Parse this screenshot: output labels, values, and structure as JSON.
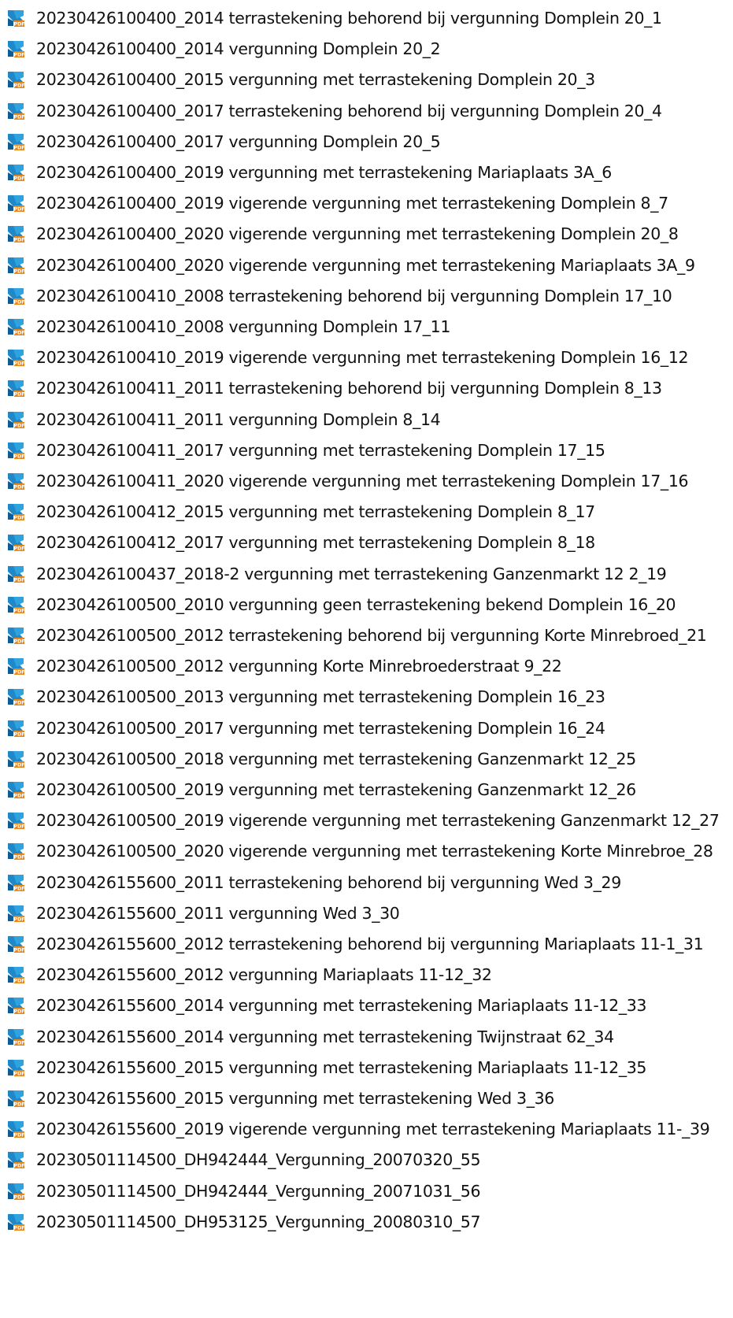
{
  "file_list": {
    "icon": "pdf-file-icon",
    "colors": {
      "icon_blue": "#1e88c8",
      "icon_blue_dark": "#0f5d96",
      "icon_orange": "#e8871e",
      "text": "#111111"
    },
    "items": [
      {
        "name": "20230426100400_2014 terrastekening behorend bij vergunning Domplein 20_1"
      },
      {
        "name": "20230426100400_2014 vergunning Domplein 20_2"
      },
      {
        "name": "20230426100400_2015 vergunning met terrastekening Domplein 20_3"
      },
      {
        "name": "20230426100400_2017 terrastekening behorend bij vergunning Domplein 20_4"
      },
      {
        "name": "20230426100400_2017 vergunning Domplein 20_5"
      },
      {
        "name": "20230426100400_2019 vergunning met terrastekening Mariaplaats 3A_6"
      },
      {
        "name": "20230426100400_2019 vigerende vergunning met terrastekening Domplein 8_7"
      },
      {
        "name": "20230426100400_2020 vigerende vergunning met terrastekening Domplein 20_8"
      },
      {
        "name": "20230426100400_2020 vigerende vergunning met terrastekening Mariaplaats 3A_9"
      },
      {
        "name": "20230426100410_2008 terrastekening behorend bij vergunning Domplein 17_10"
      },
      {
        "name": "20230426100410_2008 vergunning Domplein 17_11"
      },
      {
        "name": "20230426100410_2019 vigerende vergunning met terrastekening Domplein 16_12"
      },
      {
        "name": "20230426100411_2011 terrastekening behorend bij vergunning Domplein 8_13"
      },
      {
        "name": "20230426100411_2011 vergunning Domplein 8_14"
      },
      {
        "name": "20230426100411_2017 vergunning met terrastekening Domplein 17_15"
      },
      {
        "name": "20230426100411_2020 vigerende vergunning met terrastekening Domplein 17_16"
      },
      {
        "name": "20230426100412_2015 vergunning met terrastekening Domplein 8_17"
      },
      {
        "name": "20230426100412_2017 vergunning met terrastekening Domplein 8_18"
      },
      {
        "name": "20230426100437_2018-2 vergunning met terrastekening Ganzenmarkt 12 2_19"
      },
      {
        "name": "20230426100500_2010 vergunning geen terrastekening bekend Domplein 16_20"
      },
      {
        "name": "20230426100500_2012 terrastekening behorend bij vergunning Korte Minrebroed_21"
      },
      {
        "name": "20230426100500_2012 vergunning Korte Minrebroederstraat 9_22"
      },
      {
        "name": "20230426100500_2013 vergunning met terrastekening Domplein 16_23"
      },
      {
        "name": "20230426100500_2017 vergunning met terrastekening Domplein 16_24"
      },
      {
        "name": "20230426100500_2018 vergunning met terrastekening Ganzenmarkt 12_25"
      },
      {
        "name": "20230426100500_2019 vergunning met terrastekening Ganzenmarkt 12_26"
      },
      {
        "name": "20230426100500_2019 vigerende vergunning met terrastekening Ganzenmarkt 12_27"
      },
      {
        "name": "20230426100500_2020 vigerende vergunning met terrastekening Korte Minrebroe_28"
      },
      {
        "name": "20230426155600_2011 terrastekening behorend bij vergunning Wed 3_29"
      },
      {
        "name": "20230426155600_2011 vergunning Wed 3_30"
      },
      {
        "name": "20230426155600_2012 terrastekening behorend bij vergunning Mariaplaats 11-1_31"
      },
      {
        "name": "20230426155600_2012 vergunning Mariaplaats 11-12_32"
      },
      {
        "name": "20230426155600_2014 vergunning met terrastekening Mariaplaats 11-12_33"
      },
      {
        "name": "20230426155600_2014 vergunning met terrastekening Twijnstraat 62_34"
      },
      {
        "name": "20230426155600_2015 vergunning met terrastekening Mariaplaats 11-12_35"
      },
      {
        "name": "20230426155600_2015 vergunning met terrastekening Wed 3_36"
      },
      {
        "name": "20230426155600_2019 vigerende vergunning met terrastekening Mariaplaats 11-_39"
      },
      {
        "name": "20230501114500_DH942444_Vergunning_20070320_55"
      },
      {
        "name": "20230501114500_DH942444_Vergunning_20071031_56"
      },
      {
        "name": "20230501114500_DH953125_Vergunning_20080310_57"
      }
    ]
  }
}
